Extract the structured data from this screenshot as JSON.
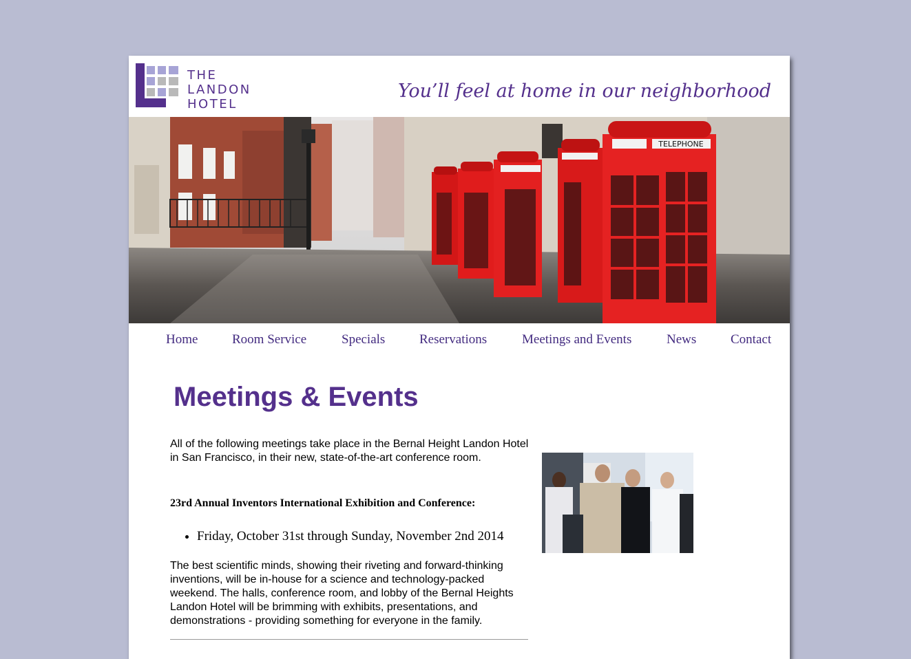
{
  "brand": {
    "logo_lines": [
      "THE",
      "LANDON",
      "HOTEL"
    ],
    "tagline": "You’ll feel at home in our neighborhood",
    "colors": {
      "accent": "#54308c",
      "nav": "#432b80",
      "background": "#b9bcd2"
    }
  },
  "hero": {
    "image": "london-street-red-telephone-boxes",
    "booth_sign": "TELEPHONE"
  },
  "nav": {
    "items": [
      {
        "label": "Home"
      },
      {
        "label": "Room Service"
      },
      {
        "label": "Specials"
      },
      {
        "label": "Reservations"
      },
      {
        "label": "Meetings and Events"
      },
      {
        "label": "News"
      },
      {
        "label": "Contact"
      }
    ]
  },
  "main": {
    "title": "Meetings & Events",
    "intro": "All of the following meetings take place in the Bernal Height Landon Hotel in San Francisco, in their new, state-of-the-art conference room.",
    "event": {
      "name": "23rd Annual Inventors International Exhibition and Conference:",
      "dates": [
        "Friday, October 31st through Sunday, November 2nd 2014"
      ],
      "description": "The best scientific minds, showing their riveting and forward-thinking inventions, will be in-house for a science and technology-packed weekend. The halls, conference room, and lobby of the Bernal Heights Landon Hotel will be brimming with exhibits, presentations, and demonstrations - providing something for everyone in the family."
    },
    "photo": "conference-attendees-photo"
  }
}
